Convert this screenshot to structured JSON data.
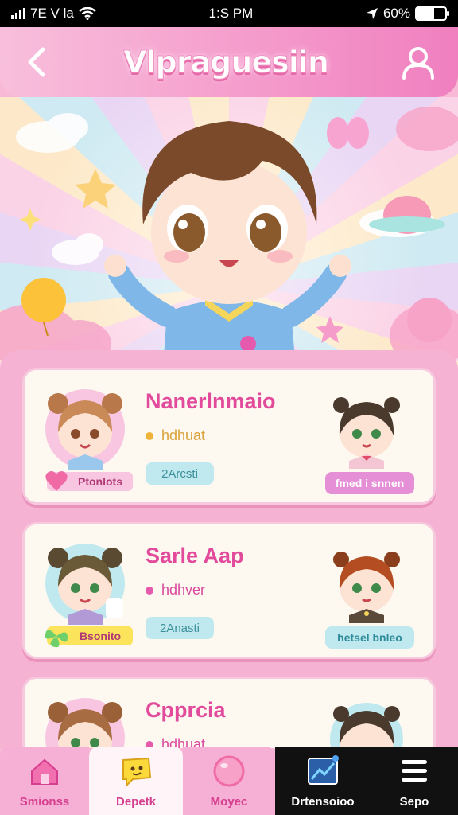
{
  "status_bar": {
    "carrier": "7E V la",
    "time": "1:S PM",
    "battery": "60%",
    "battery_level": 0.6
  },
  "header": {
    "title": "Vlpraguesiin"
  },
  "cards": [
    {
      "title": "Nanerlnmaio",
      "status": "hdhuat",
      "status_color": "#f0b33a",
      "count": "2Arcsti",
      "badge": "Ptonlots",
      "badge_color": "#f9c6e2",
      "action": "fmed i snnen",
      "action_color": "#e58fd6",
      "action_text_color": "#ffffff"
    },
    {
      "title": "Sarle Aap",
      "status": "hdhver",
      "status_color": "#e65aae",
      "count": "2Anasti",
      "badge": "Bsonito",
      "badge_color": "#fbe35c",
      "action": "hetsel bnleo",
      "action_color": "#bfe9ee",
      "action_text_color": "#2f8c9b"
    },
    {
      "title": "Cpprcia",
      "status": "hdhuat",
      "status_color": "#e65aae",
      "count": "",
      "badge": "",
      "badge_color": "#f9c6e2",
      "action": "",
      "action_color": "#e58fd6",
      "action_text_color": "#ffffff"
    }
  ],
  "nav": [
    {
      "label": "Smionss",
      "icon": "home-icon"
    },
    {
      "label": "Depetk",
      "icon": "chat-icon"
    },
    {
      "label": "Moyec",
      "icon": "heart-icon"
    },
    {
      "label": "Drtensoioo",
      "icon": "chart-icon"
    },
    {
      "label": "Sepo",
      "icon": "menu-icon"
    }
  ],
  "colors": {
    "accent": "#e24b9b",
    "header": "#f59fcd",
    "nav_dark": "#111111"
  }
}
